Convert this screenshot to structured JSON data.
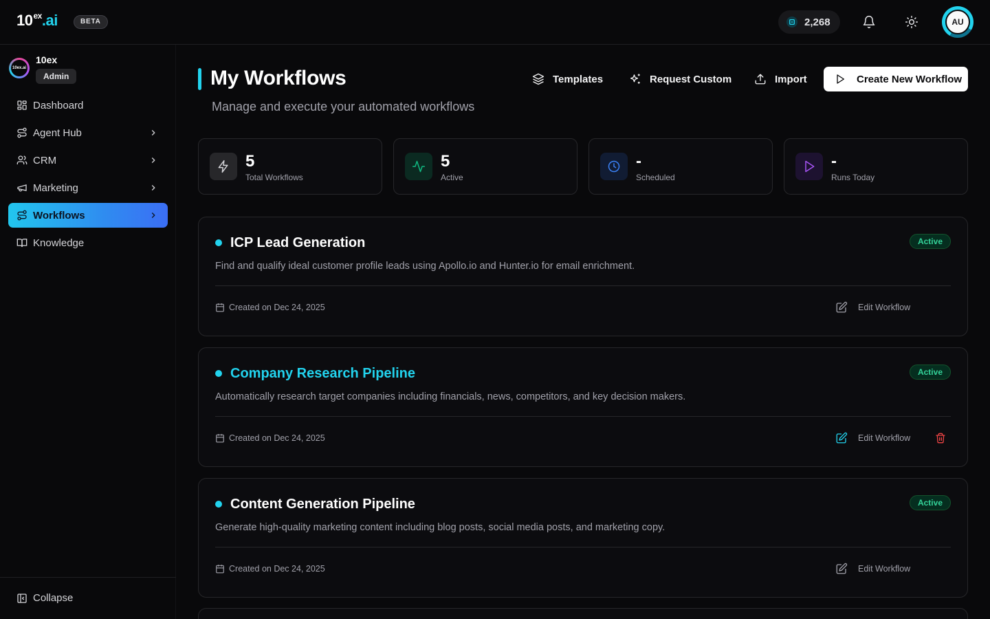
{
  "topbar": {
    "logo_main": "10",
    "logo_sup": "ex",
    "logo_suffix": ".ai",
    "beta_label": "BETA",
    "credits": "2,268",
    "avatar_initials": "AU"
  },
  "sidebar": {
    "org_logo_text": "10ex.ai",
    "org_name": "10ex",
    "org_role": "Admin",
    "items": [
      {
        "label": "Dashboard",
        "icon": "grid-icon",
        "has_chevron": false
      },
      {
        "label": "Agent Hub",
        "icon": "route-icon",
        "has_chevron": true
      },
      {
        "label": "CRM",
        "icon": "users-icon",
        "has_chevron": true
      },
      {
        "label": "Marketing",
        "icon": "megaphone-icon",
        "has_chevron": true
      },
      {
        "label": "Workflows",
        "icon": "workflow-icon",
        "has_chevron": true,
        "active": true
      },
      {
        "label": "Knowledge",
        "icon": "book-icon",
        "has_chevron": false
      }
    ],
    "collapse_label": "Collapse"
  },
  "header": {
    "title": "My Workflows",
    "subtitle": "Manage and execute your automated workflows",
    "templates_label": "Templates",
    "request_custom_label": "Request Custom",
    "import_label": "Import",
    "create_label": "Create New Workflow"
  },
  "stats": [
    {
      "value": "5",
      "label": "Total Workflows",
      "icon": "bolt-icon",
      "color": "#d4d4d8"
    },
    {
      "value": "5",
      "label": "Active",
      "icon": "activity-icon",
      "color": "#10b981"
    },
    {
      "value": "-",
      "label": "Scheduled",
      "icon": "clock-icon",
      "color": "#3b82f6"
    },
    {
      "value": "-",
      "label": "Runs Today",
      "icon": "play-icon",
      "color": "#a855f7"
    }
  ],
  "workflows": [
    {
      "title": "ICP Lead Generation",
      "status": "Active",
      "description": "Find and qualify ideal customer profile leads using Apollo.io and Hunter.io for email enrichment.",
      "created": "Created on Dec 24, 2025",
      "edit_label": "Edit Workflow"
    },
    {
      "title": "Company Research Pipeline",
      "status": "Active",
      "description": "Automatically research target companies including financials, news, competitors, and key decision makers.",
      "created": "Created on Dec 24, 2025",
      "edit_label": "Edit Workflow"
    },
    {
      "title": "Content Generation Pipeline",
      "status": "Active",
      "description": "Generate high-quality marketing content including blog posts, social media posts, and marketing copy.",
      "created": "Created on Dec 24, 2025",
      "edit_label": "Edit Workflow"
    }
  ],
  "colors": {
    "accent": "#22d3ee",
    "background": "#09090b",
    "card_border": "#27272a",
    "active_badge": "#34d399",
    "danger": "#ef4444"
  }
}
